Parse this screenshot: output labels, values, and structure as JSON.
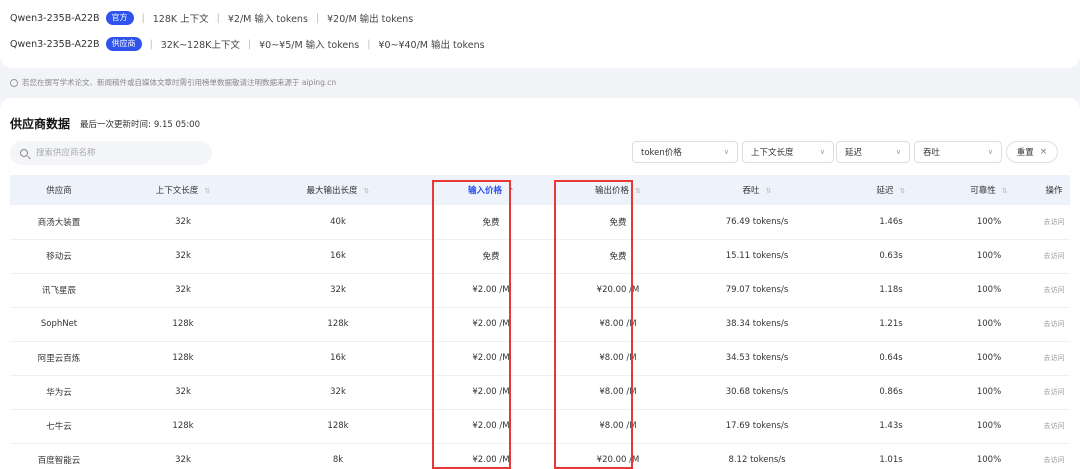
{
  "models": [
    {
      "name": "Qwen3-235B-A22B",
      "badge": "官方",
      "specs": [
        "128K 上下文",
        "¥2/M 输入 tokens",
        "¥20/M 输出 tokens"
      ]
    },
    {
      "name": "Qwen3-235B-A22B",
      "badge": "供应商",
      "specs": [
        "32K~128K上下文",
        "¥0~¥5/M 输入 tokens",
        "¥0~¥40/M 输出 tokens"
      ]
    }
  ],
  "notice": "若您在撰写学术论文、新闻稿件或自媒体文章时需引用榜单数据敬请注明数据来源于 aiping.cn",
  "section": {
    "title": "供应商数据",
    "update_label": "最后一次更新时间:",
    "update_time": "9.15 05:00"
  },
  "search": {
    "placeholder": "搜索供应商名称"
  },
  "filters": [
    "token价格",
    "上下文长度",
    "延迟",
    "吞吐"
  ],
  "reset_label": "重置",
  "table": {
    "headers": [
      "供应商",
      "上下文长度",
      "最大输出长度",
      "输入价格",
      "输出价格",
      "吞吐",
      "延迟",
      "可靠性",
      "操作"
    ],
    "rows": [
      [
        "商汤大装置",
        "32k",
        "40k",
        "免费",
        "免费",
        "76.49 tokens/s",
        "1.46s",
        "100%",
        "去访问"
      ],
      [
        "移动云",
        "32k",
        "16k",
        "免费",
        "免费",
        "15.11 tokens/s",
        "0.63s",
        "100%",
        "去访问"
      ],
      [
        "讯飞星辰",
        "32k",
        "32k",
        "¥2.00 /M",
        "¥20.00 /M",
        "79.07 tokens/s",
        "1.18s",
        "100%",
        "去访问"
      ],
      [
        "SophNet",
        "128k",
        "128k",
        "¥2.00 /M",
        "¥8.00 /M",
        "38.34 tokens/s",
        "1.21s",
        "100%",
        "去访问"
      ],
      [
        "阿里云百炼",
        "128k",
        "16k",
        "¥2.00 /M",
        "¥8.00 /M",
        "34.53 tokens/s",
        "0.64s",
        "100%",
        "去访问"
      ],
      [
        "华为云",
        "32k",
        "32k",
        "¥2.00 /M",
        "¥8.00 /M",
        "30.68 tokens/s",
        "0.86s",
        "100%",
        "去访问"
      ],
      [
        "七牛云",
        "128k",
        "128k",
        "¥2.00 /M",
        "¥8.00 /M",
        "17.69 tokens/s",
        "1.43s",
        "100%",
        "去访问"
      ],
      [
        "百度智能云",
        "32k",
        "8k",
        "¥2.00 /M",
        "¥20.00 /M",
        "8.12 tokens/s",
        "1.01s",
        "100%",
        "去访问"
      ]
    ]
  },
  "colors": {
    "accent": "#2f54eb",
    "highlight": "#e53935",
    "header_bg": "#eef3fb"
  }
}
